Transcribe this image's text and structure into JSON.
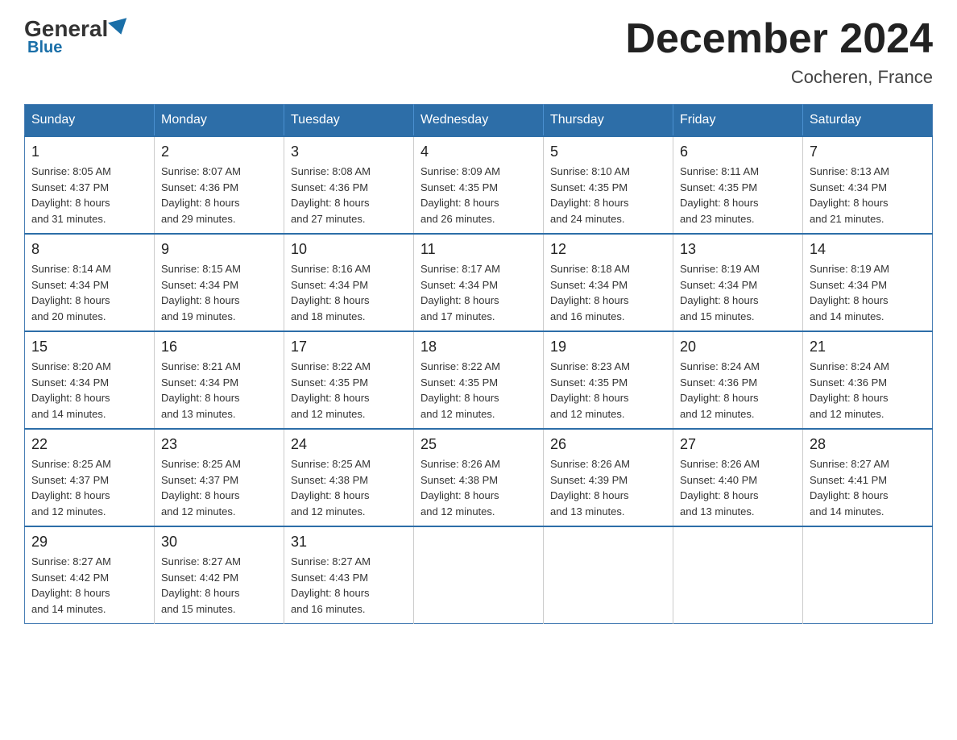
{
  "logo": {
    "general": "General",
    "blue": "Blue"
  },
  "title": "December 2024",
  "location": "Cocheren, France",
  "days_header": [
    "Sunday",
    "Monday",
    "Tuesday",
    "Wednesday",
    "Thursday",
    "Friday",
    "Saturday"
  ],
  "weeks": [
    [
      {
        "day": "1",
        "sunrise": "8:05 AM",
        "sunset": "4:37 PM",
        "daylight": "8 hours and 31 minutes."
      },
      {
        "day": "2",
        "sunrise": "8:07 AM",
        "sunset": "4:36 PM",
        "daylight": "8 hours and 29 minutes."
      },
      {
        "day": "3",
        "sunrise": "8:08 AM",
        "sunset": "4:36 PM",
        "daylight": "8 hours and 27 minutes."
      },
      {
        "day": "4",
        "sunrise": "8:09 AM",
        "sunset": "4:35 PM",
        "daylight": "8 hours and 26 minutes."
      },
      {
        "day": "5",
        "sunrise": "8:10 AM",
        "sunset": "4:35 PM",
        "daylight": "8 hours and 24 minutes."
      },
      {
        "day": "6",
        "sunrise": "8:11 AM",
        "sunset": "4:35 PM",
        "daylight": "8 hours and 23 minutes."
      },
      {
        "day": "7",
        "sunrise": "8:13 AM",
        "sunset": "4:34 PM",
        "daylight": "8 hours and 21 minutes."
      }
    ],
    [
      {
        "day": "8",
        "sunrise": "8:14 AM",
        "sunset": "4:34 PM",
        "daylight": "8 hours and 20 minutes."
      },
      {
        "day": "9",
        "sunrise": "8:15 AM",
        "sunset": "4:34 PM",
        "daylight": "8 hours and 19 minutes."
      },
      {
        "day": "10",
        "sunrise": "8:16 AM",
        "sunset": "4:34 PM",
        "daylight": "8 hours and 18 minutes."
      },
      {
        "day": "11",
        "sunrise": "8:17 AM",
        "sunset": "4:34 PM",
        "daylight": "8 hours and 17 minutes."
      },
      {
        "day": "12",
        "sunrise": "8:18 AM",
        "sunset": "4:34 PM",
        "daylight": "8 hours and 16 minutes."
      },
      {
        "day": "13",
        "sunrise": "8:19 AM",
        "sunset": "4:34 PM",
        "daylight": "8 hours and 15 minutes."
      },
      {
        "day": "14",
        "sunrise": "8:19 AM",
        "sunset": "4:34 PM",
        "daylight": "8 hours and 14 minutes."
      }
    ],
    [
      {
        "day": "15",
        "sunrise": "8:20 AM",
        "sunset": "4:34 PM",
        "daylight": "8 hours and 14 minutes."
      },
      {
        "day": "16",
        "sunrise": "8:21 AM",
        "sunset": "4:34 PM",
        "daylight": "8 hours and 13 minutes."
      },
      {
        "day": "17",
        "sunrise": "8:22 AM",
        "sunset": "4:35 PM",
        "daylight": "8 hours and 12 minutes."
      },
      {
        "day": "18",
        "sunrise": "8:22 AM",
        "sunset": "4:35 PM",
        "daylight": "8 hours and 12 minutes."
      },
      {
        "day": "19",
        "sunrise": "8:23 AM",
        "sunset": "4:35 PM",
        "daylight": "8 hours and 12 minutes."
      },
      {
        "day": "20",
        "sunrise": "8:24 AM",
        "sunset": "4:36 PM",
        "daylight": "8 hours and 12 minutes."
      },
      {
        "day": "21",
        "sunrise": "8:24 AM",
        "sunset": "4:36 PM",
        "daylight": "8 hours and 12 minutes."
      }
    ],
    [
      {
        "day": "22",
        "sunrise": "8:25 AM",
        "sunset": "4:37 PM",
        "daylight": "8 hours and 12 minutes."
      },
      {
        "day": "23",
        "sunrise": "8:25 AM",
        "sunset": "4:37 PM",
        "daylight": "8 hours and 12 minutes."
      },
      {
        "day": "24",
        "sunrise": "8:25 AM",
        "sunset": "4:38 PM",
        "daylight": "8 hours and 12 minutes."
      },
      {
        "day": "25",
        "sunrise": "8:26 AM",
        "sunset": "4:38 PM",
        "daylight": "8 hours and 12 minutes."
      },
      {
        "day": "26",
        "sunrise": "8:26 AM",
        "sunset": "4:39 PM",
        "daylight": "8 hours and 13 minutes."
      },
      {
        "day": "27",
        "sunrise": "8:26 AM",
        "sunset": "4:40 PM",
        "daylight": "8 hours and 13 minutes."
      },
      {
        "day": "28",
        "sunrise": "8:27 AM",
        "sunset": "4:41 PM",
        "daylight": "8 hours and 14 minutes."
      }
    ],
    [
      {
        "day": "29",
        "sunrise": "8:27 AM",
        "sunset": "4:42 PM",
        "daylight": "8 hours and 14 minutes."
      },
      {
        "day": "30",
        "sunrise": "8:27 AM",
        "sunset": "4:42 PM",
        "daylight": "8 hours and 15 minutes."
      },
      {
        "day": "31",
        "sunrise": "8:27 AM",
        "sunset": "4:43 PM",
        "daylight": "8 hours and 16 minutes."
      },
      null,
      null,
      null,
      null
    ]
  ],
  "labels": {
    "sunrise": "Sunrise:",
    "sunset": "Sunset:",
    "daylight": "Daylight:"
  }
}
